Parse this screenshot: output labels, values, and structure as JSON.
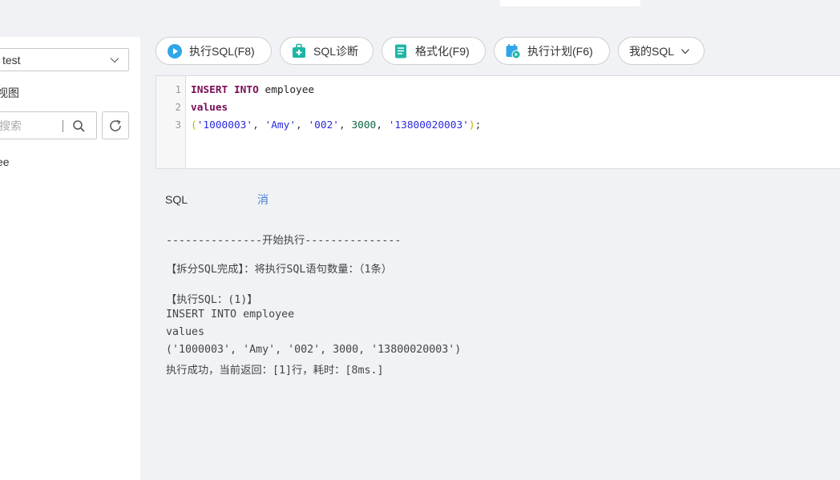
{
  "sidebar": {
    "db_select_value": "test",
    "view_label": "视图",
    "search_placeholder": "搜索",
    "tree_item": "ee"
  },
  "toolbar": {
    "run_label": "执行SQL(F8)",
    "diagnose_label": "SQL诊断",
    "format_label": "格式化(F9)",
    "plan_label": "执行计划(F6)",
    "my_sql_label": "我的SQL"
  },
  "editor": {
    "line_numbers": [
      "1",
      "2",
      "3"
    ],
    "kw_insert": "INSERT",
    "kw_into": "INTO",
    "table": "employee",
    "kw_values": "values",
    "open_paren": "(",
    "val1": "'1000003'",
    "val2": "'Amy'",
    "val3": "'002'",
    "val4": "3000",
    "val5": "'13800020003'",
    "close_paren": ")",
    "comma": ",",
    "semicolon": ";"
  },
  "tabs": {
    "history_label": "SQL执行记录",
    "message_label": "消息"
  },
  "console": {
    "lines": [
      "---------------开始执行---------------",
      "【拆分SQL完成】：将执行SQL语句数量：（1条）",
      "【执行SQL：(1)】",
      "INSERT INTO employee",
      "values",
      "('1000003', 'Amy', '002', 3000, '13800020003')",
      "执行成功，当前返回：[1]行，耗时：[8ms.]"
    ]
  },
  "colors": {
    "accent_blue": "#4a7fd0",
    "icon_blue": "#2fa6e8",
    "icon_teal": "#1fb5a4",
    "keyword": "#7a0f57",
    "string": "#2a2ae0",
    "number": "#116644"
  },
  "icons": {
    "run": "play-circle-icon",
    "diagnose": "medkit-icon",
    "format": "document-icon",
    "plan": "calendar-play-icon",
    "chevron": "chevron-down-icon",
    "search": "search-icon",
    "refresh": "refresh-icon"
  }
}
